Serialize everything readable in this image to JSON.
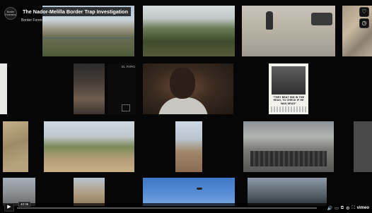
{
  "video": {
    "title": "The Nador-Melilla Border Trap Investigation",
    "byline": "Border Forensics",
    "logo_text": "Border Forensics",
    "corner_label": "EL FARO",
    "progress_fraction": 0.0,
    "time_label": "40:36"
  },
  "newspaper": {
    "headline": "\"THEY BEAT HIM IN THE HEAD, TO CHECK IF HE WAS DEAD\""
  },
  "side_controls": [
    {
      "name": "like-icon",
      "glyph": "♡"
    },
    {
      "name": "clock-icon",
      "glyph": "◷"
    }
  ],
  "player_controls": {
    "play_glyph": "▶",
    "volume_glyph": "🔊",
    "captions_glyph": "▭",
    "pip_glyph": "⧉",
    "settings_glyph": "⚙",
    "fullscreen_glyph": "⛶",
    "brand": "vimeo"
  },
  "colors": {
    "accent": "#00adef"
  }
}
